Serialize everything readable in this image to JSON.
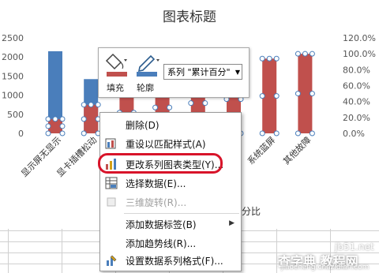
{
  "chart_data": {
    "type": "bar",
    "title": "图表标题",
    "categories": [
      "显示屏无显示",
      "显卡插槽松动",
      "",
      "",
      "",
      "",
      "系统蓝屏",
      "其他故障"
    ],
    "series": [
      {
        "name": "",
        "type": "bar",
        "axis": "left",
        "color": "#4a7ebb",
        "values": [
          2150,
          1420,
          0,
          0,
          0,
          0,
          0,
          0
        ]
      },
      {
        "name": "累计百分比",
        "type": "bar",
        "axis": "right",
        "color": "#c0504d",
        "values": [
          0.18,
          0.36,
          0.52,
          0.65,
          0.76,
          0.86,
          0.94,
          1.0
        ]
      }
    ],
    "y_left": {
      "ticks": [
        "2500",
        "2000",
        "1500",
        "1000",
        "500",
        "0"
      ],
      "min": 0,
      "max": 2500
    },
    "y_right": {
      "ticks": [
        "120.0%",
        "100.0%",
        "80.0%",
        "60.0%",
        "40.0%",
        "20.0%",
        "0.0%"
      ],
      "min": 0,
      "max": 1.2
    },
    "visible_legend_fragment": "分比"
  },
  "mini_toolbar": {
    "fill_label": "填充",
    "outline_label": "轮廓",
    "series_select_value": "系列 \"累计百分\""
  },
  "context_menu": {
    "items": [
      {
        "label": "删除(D)",
        "icon": "none-icon",
        "disabled": false
      },
      {
        "label": "重设以匹配样式(A)",
        "icon": "reset-style-icon",
        "disabled": false
      },
      {
        "label": "更改系列图表类型(Y)...",
        "icon": "chart-type-icon",
        "disabled": false
      },
      {
        "label": "选择数据(E)...",
        "icon": "select-data-icon",
        "disabled": false
      },
      {
        "label": "三维旋转(R)...",
        "icon": "rotate-3d-icon",
        "disabled": true
      },
      {
        "label": "添加数据标签(B)",
        "icon": "none-icon",
        "disabled": false,
        "submenu": true
      },
      {
        "label": "添加趋势线(R)...",
        "icon": "none-icon",
        "disabled": false
      },
      {
        "label": "设置数据系列格式(F)...",
        "icon": "format-series-icon",
        "disabled": false
      }
    ]
  },
  "watermark": {
    "site": "jb51.net",
    "text_cn": "查字典 教程网",
    "url": "jiaocheng.chazidian.com"
  }
}
